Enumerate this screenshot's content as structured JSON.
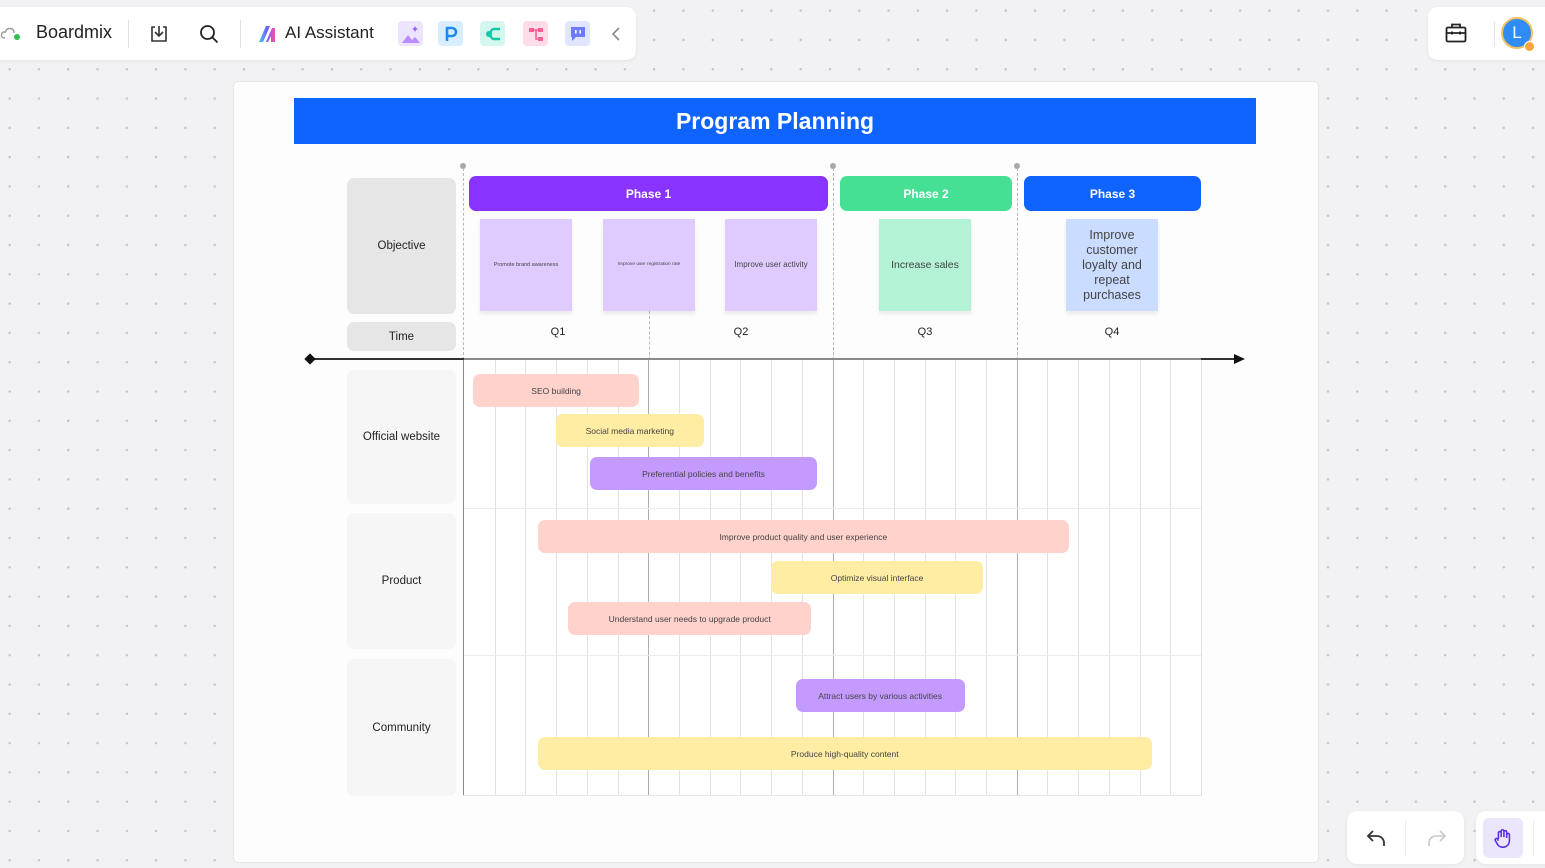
{
  "toolbar": {
    "brand": "Boardmix",
    "ai_assistant_label": "AI Assistant",
    "icons": [
      "cloud-sync-icon",
      "download-icon",
      "search-icon"
    ],
    "plugins": [
      {
        "name": "ai-image-plugin",
        "bg": "#ede4ff"
      },
      {
        "name": "presentation-plugin",
        "bg": "#d6eeff"
      },
      {
        "name": "mindmap-plugin",
        "bg": "#d3f7ef"
      },
      {
        "name": "flowchart-plugin",
        "bg": "#ffdce8"
      },
      {
        "name": "chat-plugin",
        "bg": "#e1e6ff"
      }
    ],
    "collapse_icon": "chevron-left-icon"
  },
  "top_right": {
    "toolkit_icon": "toolbox-icon",
    "avatar_initial": "L"
  },
  "board": {
    "title": "Program Planning",
    "labels": {
      "objective": "Objective",
      "time": "Time"
    },
    "phases": [
      {
        "label": "Phase 1",
        "color": "#8833ff"
      },
      {
        "label": "Phase 2",
        "color": "#46e095"
      },
      {
        "label": "Phase 3",
        "color": "#0f64ff"
      }
    ],
    "objectives": [
      {
        "text": "Promote brand awareness",
        "phase": 1,
        "color": "#dfcbff"
      },
      {
        "text": "Improve user registration rate",
        "phase": 1,
        "color": "#dfcbff"
      },
      {
        "text": "Improve user activity",
        "phase": 1,
        "color": "#dfcbff"
      },
      {
        "text": "Increase sales",
        "phase": 2,
        "color": "#b3f2d5"
      },
      {
        "text": "Improve customer loyalty and repeat purchases",
        "phase": 3,
        "color": "#cadcff"
      }
    ],
    "quarters": [
      "Q1",
      "Q2",
      "Q3",
      "Q4"
    ],
    "rows": [
      {
        "label": "Official website",
        "tasks": [
          {
            "text": "SEO building",
            "color": "pink",
            "start": 0.3,
            "end": 5.7
          },
          {
            "text": "Social media marketing",
            "color": "yellow",
            "start": 3.0,
            "end": 7.8
          },
          {
            "text": "Preferential policies and benefits",
            "color": "purple",
            "start": 4.1,
            "end": 11.5
          }
        ]
      },
      {
        "label": "Product",
        "tasks": [
          {
            "text": "Improve product quality and user experience",
            "color": "pink",
            "start": 2.4,
            "end": 19.7
          },
          {
            "text": "Optimize visual interface",
            "color": "yellow",
            "start": 10.0,
            "end": 16.9
          },
          {
            "text": "Understand user needs to upgrade product",
            "color": "pink",
            "start": 3.4,
            "end": 11.3
          }
        ]
      },
      {
        "label": "Community",
        "tasks": [
          {
            "text": "Attract users by various activities",
            "color": "purple",
            "start": 10.8,
            "end": 16.3
          },
          {
            "text": "Produce high-quality content",
            "color": "yellow",
            "start": 2.4,
            "end": 22.4
          }
        ]
      }
    ],
    "grid_columns": 24
  },
  "bottom_controls": {
    "undo_icon": "undo-icon",
    "redo_icon": "redo-icon",
    "hand_icon": "hand-tool-icon"
  }
}
